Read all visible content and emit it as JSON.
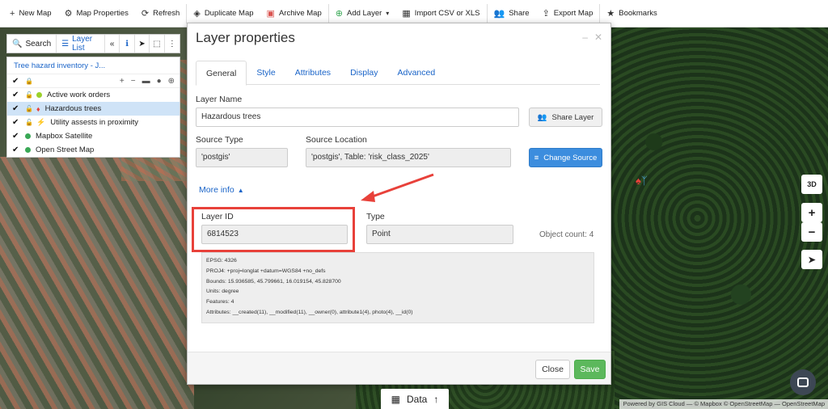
{
  "toolbar": {
    "items": [
      {
        "icon": "plus-icon",
        "label": "New Map"
      },
      {
        "icon": "gear-icon",
        "label": "Map Properties"
      },
      {
        "icon": "refresh-icon",
        "label": "Refresh"
      },
      {
        "icon": "layers-icon",
        "label": "Duplicate Map"
      },
      {
        "icon": "archive-icon",
        "label": "Archive Map"
      },
      {
        "icon": "add-circle-icon",
        "label": "Add Layer"
      },
      {
        "icon": "table-icon",
        "label": "Import CSV or XLS"
      },
      {
        "icon": "users-icon",
        "label": "Share"
      },
      {
        "icon": "export-icon",
        "label": "Export Map"
      },
      {
        "icon": "star-icon",
        "label": "Bookmarks"
      }
    ]
  },
  "left_panel": {
    "search_label": "Search",
    "layer_list_label": "Layer List",
    "map_title": "Tree hazard inventory - J...",
    "layers": [
      {
        "name": "Active work orders",
        "dot_color": "#9bd12b",
        "selected": false
      },
      {
        "name": "Hazardous trees",
        "dot_color": "#e8413a",
        "selected": true
      },
      {
        "name": "Utility assests in proximity",
        "dot_color": "#4aa3df",
        "selected": false
      },
      {
        "name": "Mapbox Satellite",
        "dot_color": "#3aa856",
        "selected": false
      },
      {
        "name": "Open Street Map",
        "dot_color": "#3aa856",
        "selected": false
      }
    ]
  },
  "modal": {
    "title": "Layer properties",
    "tabs": [
      "General",
      "Style",
      "Attributes",
      "Display",
      "Advanced"
    ],
    "active_tab": "General",
    "layer_name_label": "Layer Name",
    "layer_name_value": "Hazardous trees",
    "share_layer_label": "Share Layer",
    "source_type_label": "Source Type",
    "source_type_value": "'postgis'",
    "source_location_label": "Source Location",
    "source_location_value": "'postgis', Table: 'risk_class_2025'",
    "change_source_label": "Change Source",
    "more_info_label": "More info",
    "layer_id_label": "Layer ID",
    "layer_id_value": "6814523",
    "type_label": "Type",
    "type_value": "Point",
    "object_count": "Object count: 4",
    "info_lines": [
      "EPSG: 4326",
      "PROJ4: +proj=longlat +datum=WGS84 +no_defs",
      "Bounds: 15.936585, 45.799661, 16.019154, 45.828700",
      "Units: degree",
      "Features: 4",
      "Attributes: __created(11), __modified(11), __owner(0), attribute1(4), photo(4), __id(0)"
    ],
    "close_label": "Close",
    "save_label": "Save"
  },
  "map_controls": {
    "three_d": "3D",
    "zoom_in": "+",
    "zoom_out": "−"
  },
  "data_button": {
    "label": "Data"
  },
  "credit": "Powered by GIS Cloud — © Mapbox © OpenStreetMap — OpenStreetMap",
  "colors": {
    "accent": "#1a64c8",
    "highlight": "#e8413a",
    "save": "#5cb85c",
    "change_source": "#3c8dde"
  }
}
